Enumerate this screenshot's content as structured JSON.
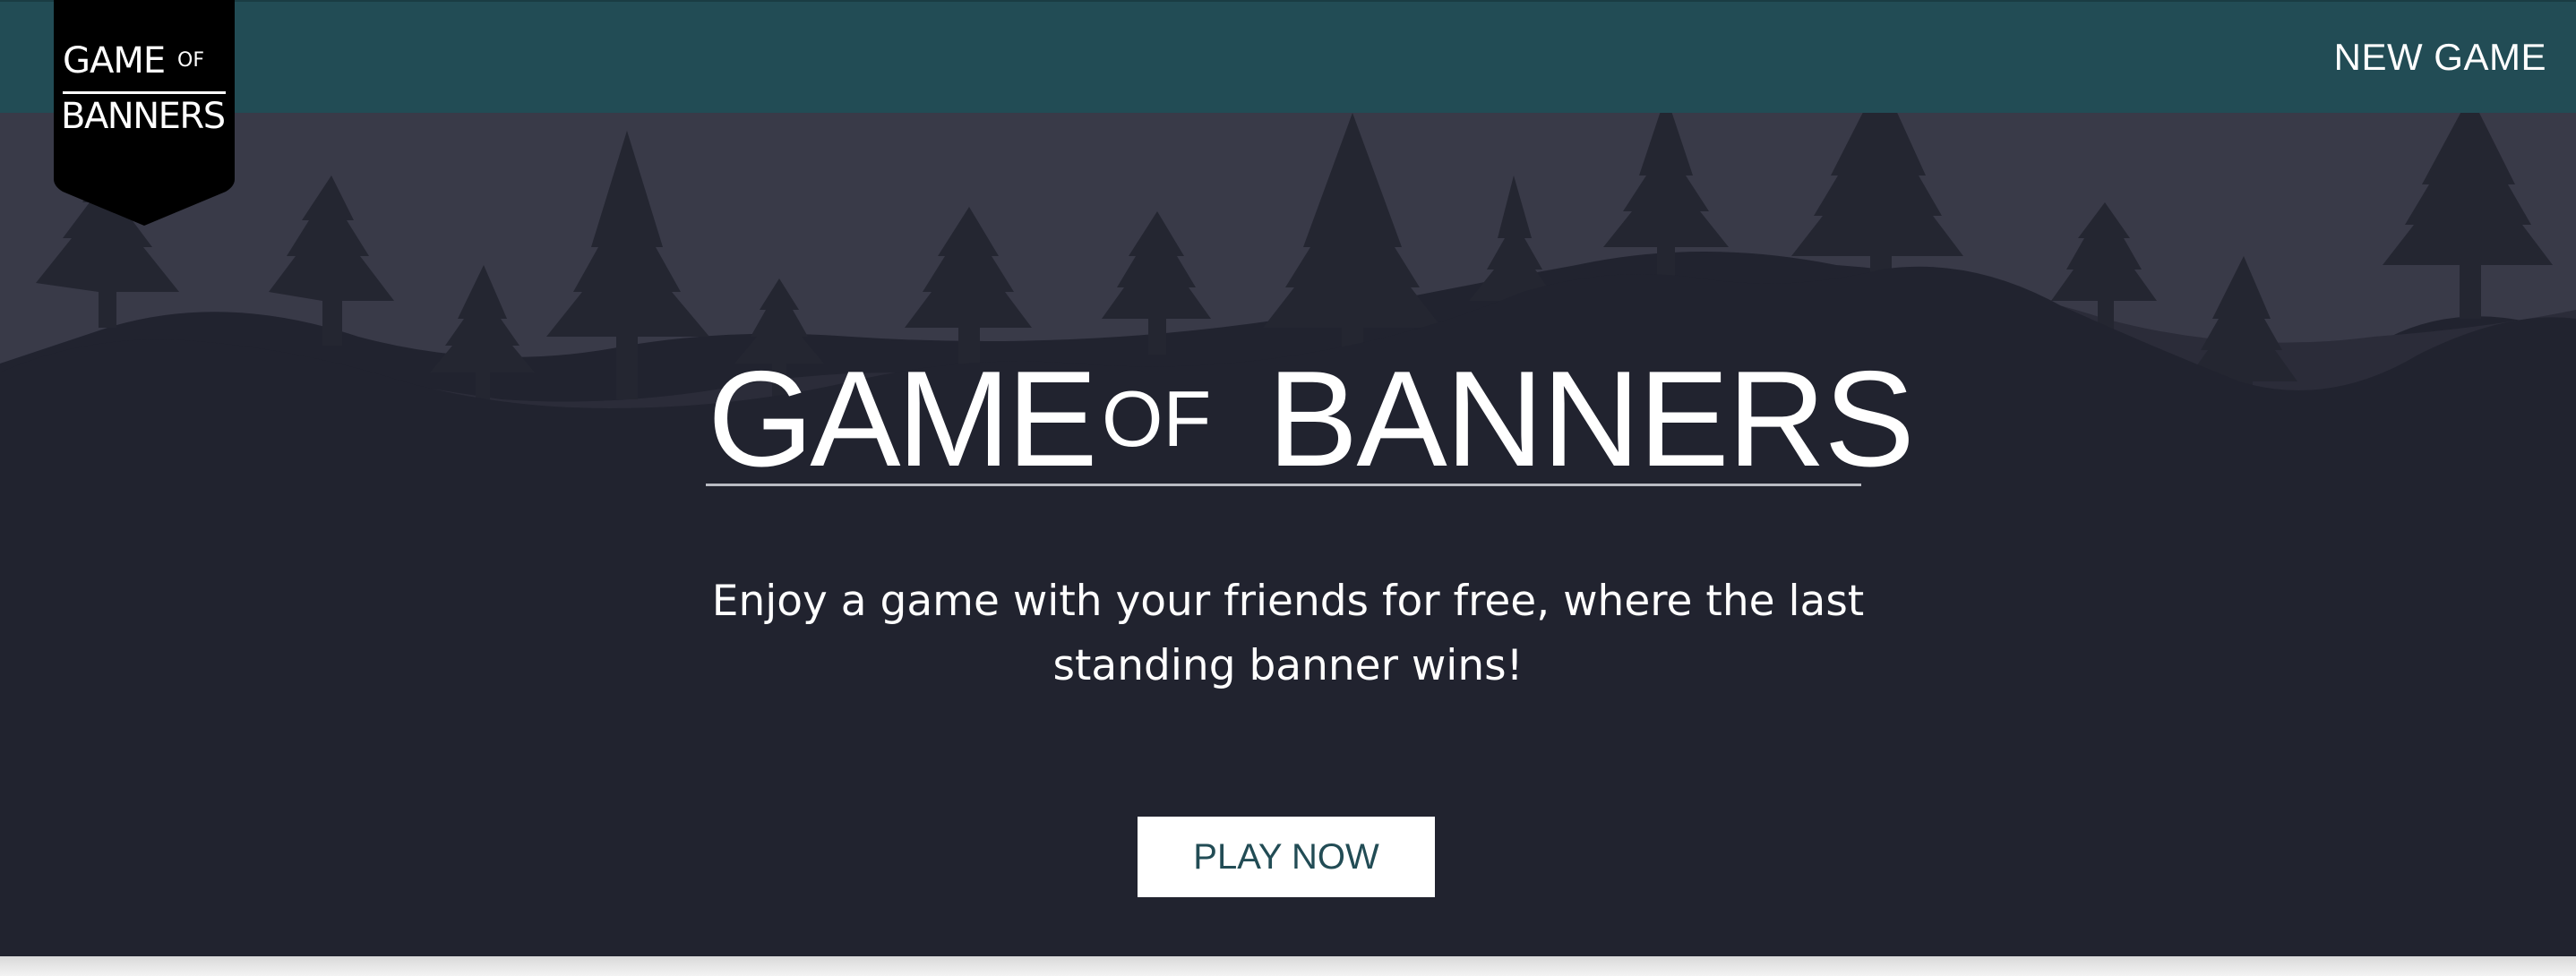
{
  "header": {
    "new_game_label": "NEW GAME",
    "background_color": "#224c55"
  },
  "logo": {
    "line1": "GAME",
    "of": "OF",
    "line2": "BANNERS",
    "banner_color": "#000000"
  },
  "hero": {
    "title_game": "GAME",
    "title_of": "OF",
    "title_banners": "BANNERS",
    "subtitle": "Enjoy a game with your friends for free, where the last standing banner wins!",
    "cta_label": "PLAY NOW",
    "background_color": "#21232f",
    "sky_color": "#393a48",
    "tree_color": "#242631"
  }
}
